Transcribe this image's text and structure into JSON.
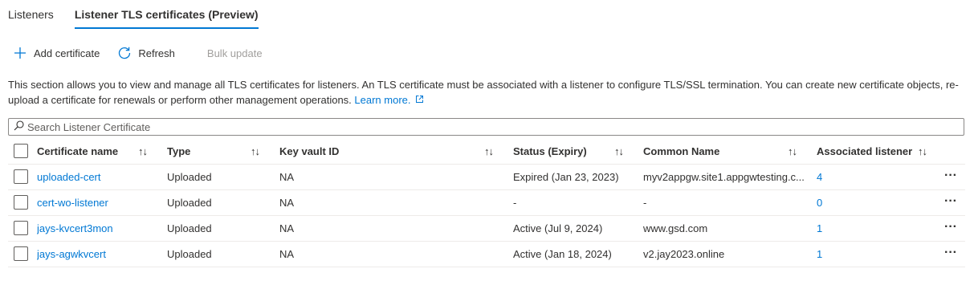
{
  "tabs": [
    {
      "label": "Listeners"
    },
    {
      "label": "Listener TLS certificates (Preview)"
    }
  ],
  "toolbar": {
    "add_label": "Add certificate",
    "refresh_label": "Refresh",
    "bulk_label": "Bulk update"
  },
  "description": {
    "text": "This section allows you to view and manage all TLS certificates for listeners. An TLS certificate must be associated with a listener to configure TLS/SSL termination. You can create new certificate objects, re-upload a certificate for renewals or perform other management operations.",
    "link": "Learn more."
  },
  "search": {
    "placeholder": "Search Listener Certificate",
    "value": ""
  },
  "table": {
    "columns": {
      "name": "Certificate name",
      "type": "Type",
      "kv": "Key vault ID",
      "status": "Status (Expiry)",
      "cn": "Common Name",
      "listener": "Associated listener"
    },
    "sort_glyph": "↑↓",
    "more_glyph": "···",
    "rows": [
      {
        "name": "uploaded-cert",
        "type": "Uploaded",
        "kv": "NA",
        "status": "Expired (Jan 23, 2023)",
        "cn": "myv2appgw.site1.appgwtesting.c...",
        "listener": "4"
      },
      {
        "name": "cert-wo-listener",
        "type": "Uploaded",
        "kv": "NA",
        "status": "-",
        "cn": "-",
        "listener": "0"
      },
      {
        "name": "jays-kvcert3mon",
        "type": "Uploaded",
        "kv": "NA",
        "status": "Active (Jul 9, 2024)",
        "cn": "www.gsd.com",
        "listener": "1"
      },
      {
        "name": "jays-agwkvcert",
        "type": "Uploaded",
        "kv": "NA",
        "status": "Active (Jan 18, 2024)",
        "cn": "v2.jay2023.online",
        "listener": "1"
      }
    ]
  },
  "colors": {
    "accent": "#0078d4",
    "text": "#323130",
    "disabled": "#a19f9d",
    "border": "#edebe9"
  }
}
